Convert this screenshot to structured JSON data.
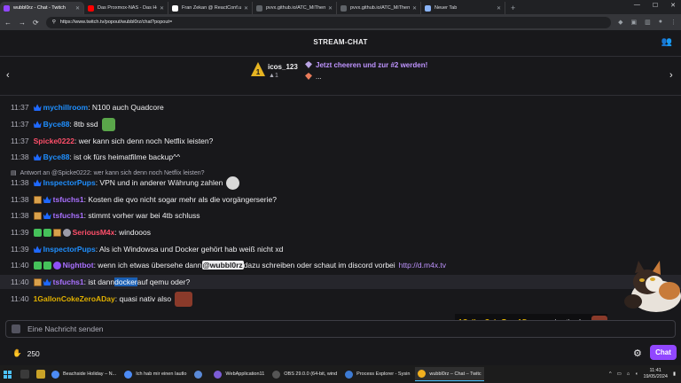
{
  "browser": {
    "tabs": [
      {
        "title": "wubbl0rz - Chat - Twitch",
        "active": true,
        "color": "#9147ff"
      },
      {
        "title": "Das Proxmox-NAS - Das Homo",
        "active": false,
        "color": "#ff0000"
      },
      {
        "title": "Fran Zekan @ ReactConf.us a",
        "active": false,
        "color": "#ffffff"
      },
      {
        "title": "pvvx.github.io/ATC_MiThermo",
        "active": false,
        "color": "#5f6368"
      },
      {
        "title": "pvvx.github.io/ATC_MiThermo",
        "active": false,
        "color": "#5f6368"
      },
      {
        "title": "Neuer Tab",
        "active": false,
        "color": "#8ab4f8"
      }
    ],
    "url": "https://www.twitch.tv/popout/wubbl0rz/chat?popout="
  },
  "header": {
    "title": "STREAM-CHAT"
  },
  "leaderboard": {
    "rank": "1",
    "user": "icos_123",
    "bits": "1",
    "cheer_text": "Jetzt cheeren und zur #2 werden!",
    "second_line": "..."
  },
  "messages": [
    {
      "time": "11:37",
      "user": "mychillroom",
      "color": "#1f8fff",
      "text": ": N100 auch Quadcore"
    },
    {
      "time": "11:37",
      "user": "Byce88",
      "color": "#1f8fff",
      "text": ": 8tb ssd"
    },
    {
      "time": "11:37",
      "user": "Spicke0222",
      "color": "#ff4f6a",
      "text": ": wer kann sich denn noch Netflix leisten?"
    },
    {
      "time": "11:38",
      "user": "Byce88",
      "color": "#1f8fff",
      "text": ": ist ok fürs heimatfilme backup^^"
    },
    {
      "time": "11:38",
      "user": "InspectorPups",
      "color": "#1f8fff",
      "text": ": VPN und in anderer Währung zahlen"
    },
    {
      "time": "11:38",
      "user": "tsfuchs1",
      "color": "#a970ff",
      "text": ": Kosten die qvo nicht sogar mehr als die vorgängerserie?"
    },
    {
      "time": "11:38",
      "user": "tsfuchs1",
      "color": "#a970ff",
      "text": ": stimmt vorher war bei 4tb schluss"
    },
    {
      "time": "11:39",
      "user": "SeriousM4x",
      "color": "#ff4f6a",
      "text": ": windooos"
    },
    {
      "time": "11:39",
      "user": "InspectorPups",
      "color": "#1f8fff",
      "text": ": Als ich Windowsa und Docker gehört hab weiß nicht xd"
    },
    {
      "time": "11:40",
      "user": "Nightbot",
      "color": "#a970ff",
      "text_a": ": wenn ich etwas übersehe dann ",
      "mention": "@wubbl0rz",
      "text_b": " dazu schreiben oder schaut im discord vorbei",
      "link": "http://d.m4x.tv"
    },
    {
      "time": "11:40",
      "user": "tsfuchs1",
      "color": "#a970ff",
      "text_a": ": ist dann ",
      "selected": "docker",
      "text_b": " auf qemu oder?"
    },
    {
      "time": "11:40",
      "user": "1GallonCokeZeroADay",
      "color": "#e0b000",
      "text": ": quasi nativ also"
    }
  ],
  "reply": {
    "text": "Antwort an @Spicke0222: wer kann sich denn noch Netflix leisten?"
  },
  "popup": {
    "user": "1GallonCokeZeroADay",
    "text": ": quasi nativ also"
  },
  "input": {
    "placeholder": "Eine Nachricht senden"
  },
  "footer": {
    "points": "250",
    "chat_button": "Chat"
  },
  "taskbar": {
    "apps": [
      "Beachside Holiday – N...",
      "Ich hab mir einen Iautlo",
      "",
      "WebApplication11",
      "OBS 29.0.0 (64-bit, wind",
      "Process Explorer - Sysin",
      "wubbl0rz – Chat – Twitc"
    ],
    "time": "11:41",
    "date": "19/05/2024"
  }
}
